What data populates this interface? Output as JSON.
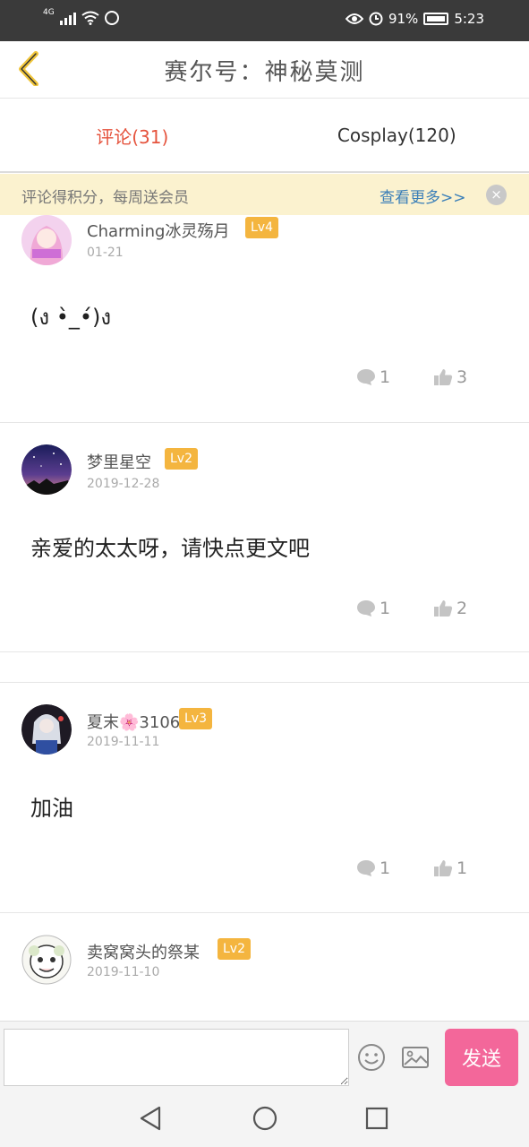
{
  "status_bar": {
    "network": "4G",
    "battery": "91%",
    "time": "5:23",
    "icons": [
      "signal-icon",
      "wifi-icon",
      "data-saver-icon",
      "eye-icon",
      "alarm-icon",
      "battery-icon"
    ]
  },
  "header": {
    "back_icon": "chevron-left-icon",
    "title": "赛尔号：神秘莫测"
  },
  "tabs": [
    {
      "label": "评论(31)",
      "active": true
    },
    {
      "label": "Cosplay(120)",
      "active": false
    }
  ],
  "notice": {
    "text": "评论得积分，每周送会员",
    "more": "查看更多>>",
    "close": "×"
  },
  "comments": [
    {
      "username": "Charming冰灵殇月",
      "level": "Lv4",
      "date": "01-21",
      "text": "(ง •̀_•́)ง",
      "reply_count": "1",
      "like_count": "3"
    },
    {
      "username": "梦里星空",
      "level": "Lv2",
      "date": "2019-12-28",
      "text": "亲爱的太太呀，请快点更文吧",
      "reply_count": "1",
      "like_count": "2"
    },
    {
      "username": "夏末🌸3106",
      "level": "Lv3",
      "date": "2019-11-11",
      "text": "加油",
      "reply_count": "1",
      "like_count": "1"
    },
    {
      "username": "卖窝窝头的祭某",
      "level": "Lv2",
      "date": "2019-11-10",
      "text": "",
      "reply_count": "",
      "like_count": ""
    }
  ],
  "input": {
    "placeholder": "",
    "value": "",
    "send_label": "发送"
  },
  "colors": {
    "accent_red": "#e5533d",
    "send_pink": "#f3679a",
    "level_badge": "#f4b53f",
    "notice_bg": "#fbf2cf",
    "link_blue": "#3b7fb8"
  }
}
